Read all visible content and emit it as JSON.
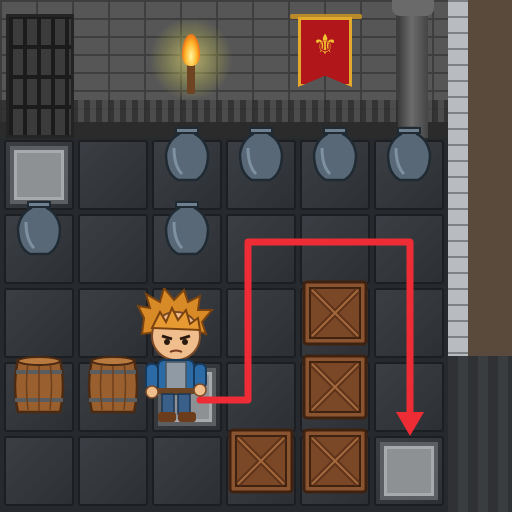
{
  "scene": {
    "type": "dungeon-puzzle",
    "grid": {
      "columns": 6,
      "rows": 5
    },
    "player": {
      "name": "hero",
      "tile": [
        2,
        3
      ]
    },
    "goal_plate": {
      "tile": [
        5,
        4
      ]
    },
    "path_arrow": {
      "color": "#ee2c36",
      "from_tile": [
        2,
        3
      ],
      "to_tile": [
        5,
        4
      ]
    },
    "pressure_plates": [
      [
        0,
        0
      ],
      [
        2,
        3
      ],
      [
        5,
        4
      ]
    ],
    "vases": [
      [
        2,
        0
      ],
      [
        3,
        0
      ],
      [
        4,
        0
      ],
      [
        5,
        0
      ],
      [
        0,
        1
      ],
      [
        2,
        1
      ]
    ],
    "barrels": [
      [
        0,
        3
      ],
      [
        1,
        3
      ]
    ],
    "crates": [
      [
        4,
        2
      ],
      [
        4,
        3
      ],
      [
        3,
        4
      ],
      [
        4,
        4
      ]
    ],
    "decor": [
      "iron-gate",
      "wall-torch",
      "heraldic-banner-fleur-de-lis",
      "stone-pillar"
    ],
    "colors": {
      "banner": "#b0161a",
      "banner_trim": "#e1aa2c",
      "arrow": "#ee2c36"
    }
  }
}
